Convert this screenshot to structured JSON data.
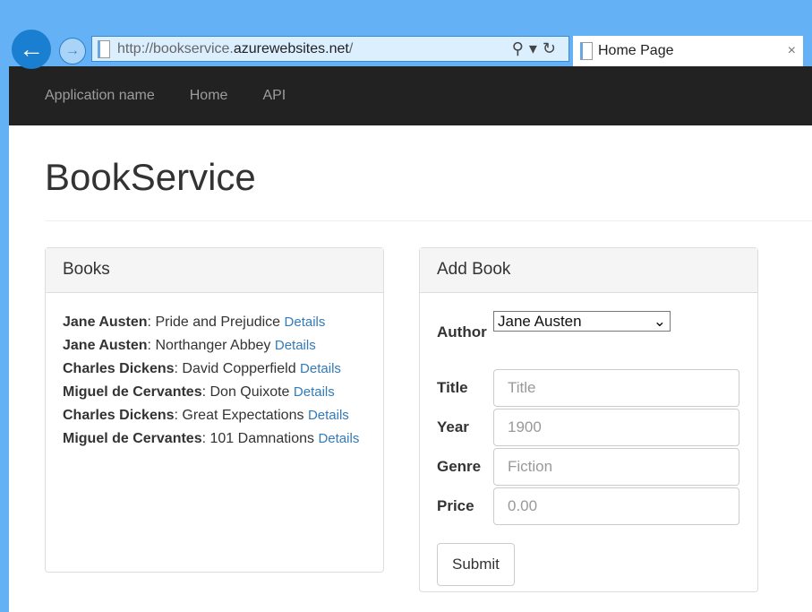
{
  "browser": {
    "url_prefix": "http://bookservice.",
    "url_domain": "azurewebsites.net",
    "url_suffix": "/",
    "tab_title": "Home Page",
    "close": "×",
    "back": "←",
    "forward": "→",
    "tools": "⚲▾↻"
  },
  "nav": {
    "brand": "Application name",
    "links": [
      "Home",
      "API"
    ]
  },
  "page_title": "BookService",
  "books": {
    "title": "Books",
    "details_label": "Details",
    "items": [
      {
        "author": "Jane Austen",
        "title": "Pride and Prejudice"
      },
      {
        "author": "Jane Austen",
        "title": "Northanger Abbey"
      },
      {
        "author": "Charles Dickens",
        "title": "David Copperfield"
      },
      {
        "author": "Miguel de Cervantes",
        "title": "Don Quixote"
      },
      {
        "author": "Charles Dickens",
        "title": "Great Expectations"
      },
      {
        "author": "Miguel de Cervantes",
        "title": "101 Damnations"
      }
    ]
  },
  "add_book": {
    "title": "Add Book",
    "author_label": "Author",
    "author_value": "Jane Austen",
    "fields": [
      {
        "label": "Title",
        "placeholder": "Title"
      },
      {
        "label": "Year",
        "placeholder": "1900"
      },
      {
        "label": "Genre",
        "placeholder": "Fiction"
      },
      {
        "label": "Price",
        "placeholder": "0.00"
      }
    ],
    "submit": "Submit"
  }
}
